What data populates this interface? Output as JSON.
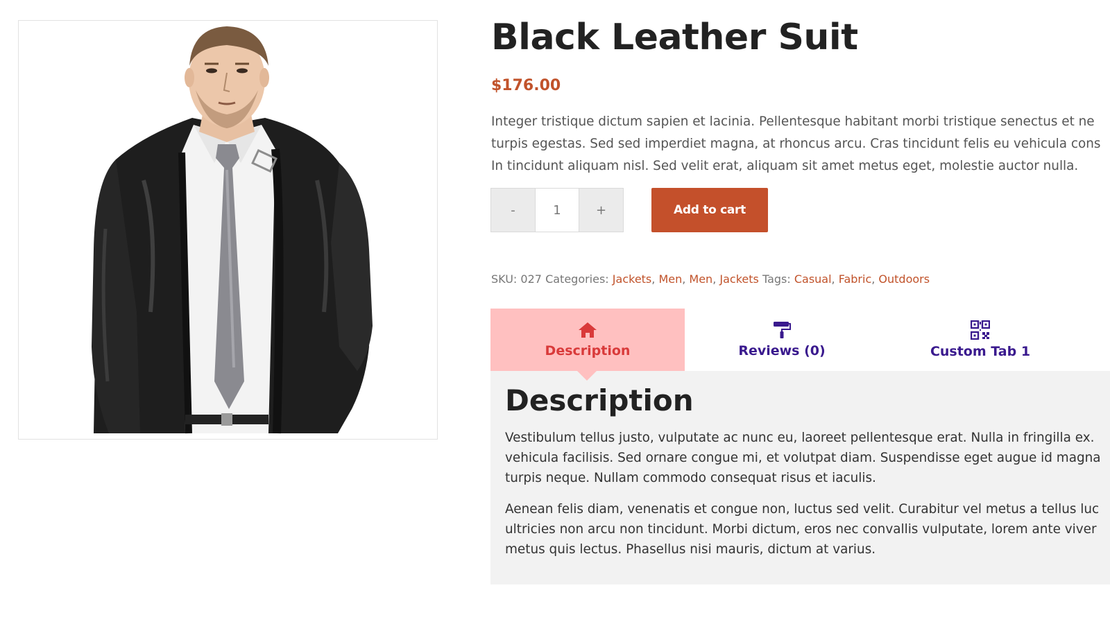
{
  "product": {
    "title": "Black Leather Suit",
    "price": "$176.00",
    "image_alt": "Man in black leather jacket",
    "short_description": [
      "Integer tristique dictum sapien et lacinia. Pellentesque habitant morbi tristique senectus et ne",
      "turpis egestas. Sed sed imperdiet magna, at rhoncus arcu. Cras tincidunt felis eu vehicula cons",
      "In tincidunt aliquam nisl. Sed velit erat, aliquam sit amet metus eget, molestie auctor nulla."
    ]
  },
  "cart": {
    "minus_label": "-",
    "quantity": "1",
    "plus_label": "+",
    "add_to_cart_label": "Add to cart"
  },
  "meta": {
    "sku_label": "SKU:",
    "sku_value": "027",
    "categories_label": "Categories:",
    "categories": [
      "Jackets",
      "Men",
      "Men",
      "Jackets"
    ],
    "tags_label": "Tags:",
    "tags": [
      "Casual",
      "Fabric",
      "Outdoors"
    ]
  },
  "tabs": [
    {
      "label": "Description",
      "icon": "home-icon",
      "active": true
    },
    {
      "label": "Reviews (0)",
      "icon": "paint-roller-icon",
      "active": false
    },
    {
      "label": "Custom Tab 1",
      "icon": "qr-code-icon",
      "active": false
    }
  ],
  "description_panel": {
    "heading": "Description",
    "paragraph1": [
      "Vestibulum tellus justo, vulputate ac nunc eu, laoreet pellentesque erat. Nulla in fringilla ex.",
      "vehicula facilisis. Sed ornare congue mi, et volutpat diam. Suspendisse eget augue id magna",
      "turpis neque. Nullam commodo consequat risus et iaculis."
    ],
    "paragraph2": [
      "Aenean felis diam, venenatis et congue non, luctus sed velit. Curabitur vel metus a tellus luc",
      "ultricies non arcu non tincidunt. Morbi dictum, eros nec convallis vulputate, lorem ante viver",
      "metus quis lectus. Phasellus nisi mauris, dictum at varius."
    ]
  },
  "colors": {
    "accent": "#c4502b",
    "active_tab_bg": "#ffc0c0",
    "active_tab_text": "#d93a3a",
    "inactive_tab_text": "#3a1a8e",
    "panel_bg": "#f2f2f2"
  }
}
